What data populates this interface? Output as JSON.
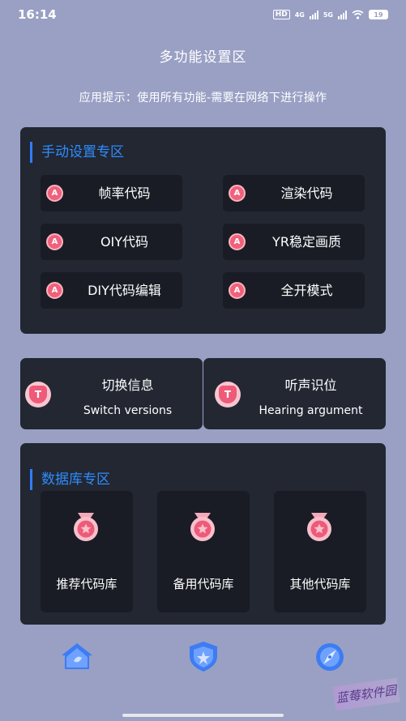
{
  "status_bar": {
    "time": "16:14",
    "hd_label": "HD",
    "net1_label": "4G",
    "net2_label": "5G",
    "battery": "19",
    "icons": [
      "hd-icon",
      "signal-icon",
      "wifi-icon",
      "battery-icon"
    ]
  },
  "header": {
    "title": "多功能设置区",
    "hint": "应用提示：使用所有功能-需要在网络下进行操作"
  },
  "manual_section": {
    "title": "手动设置专区",
    "badge_letter": "A",
    "buttons": [
      {
        "label": "帧率代码"
      },
      {
        "label": "渲染代码"
      },
      {
        "label": "OIY代码"
      },
      {
        "label": "YR稳定画质"
      },
      {
        "label": "DIY代码编辑"
      },
      {
        "label": "全开模式"
      }
    ]
  },
  "switch_cards": {
    "badge_letter": "T",
    "items": [
      {
        "title": "切换信息",
        "subtitle": "Switch versions"
      },
      {
        "title": "听声识位",
        "subtitle": "Hearing argument"
      }
    ]
  },
  "database_section": {
    "title": "数据库专区",
    "items": [
      {
        "label": "推荐代码库"
      },
      {
        "label": "备用代码库"
      },
      {
        "label": "其他代码库"
      }
    ]
  },
  "tabbar": {
    "items": [
      {
        "icon": "home-icon"
      },
      {
        "icon": "shield-icon"
      },
      {
        "icon": "compass-icon"
      }
    ]
  },
  "watermark": "蓝莓软件园",
  "colors": {
    "background": "#9aa0c4",
    "panel": "#222732",
    "button": "#191c24",
    "accent_blue": "#2f8cff",
    "badge_pink": "#f0617c"
  }
}
